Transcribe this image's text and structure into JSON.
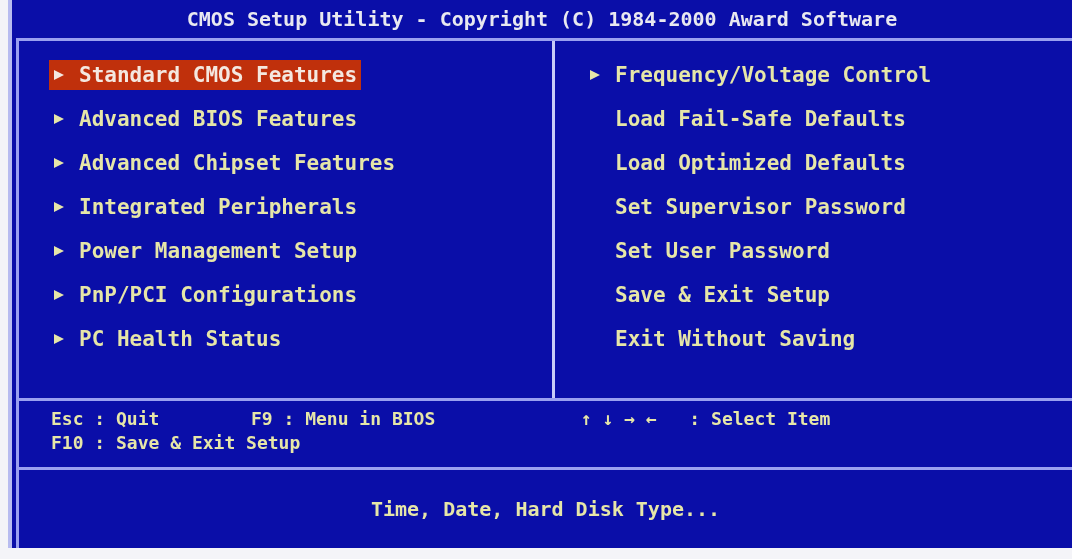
{
  "window": {
    "title": "CMOS Setup Utility - Copyright (C) 1984-2000 Award Software"
  },
  "menu_left": [
    {
      "label": "Standard CMOS Features",
      "kind": "submenu",
      "selected": true
    },
    {
      "label": "Advanced BIOS Features",
      "kind": "submenu",
      "selected": false
    },
    {
      "label": "Advanced Chipset Features",
      "kind": "submenu",
      "selected": false
    },
    {
      "label": "Integrated Peripherals",
      "kind": "submenu",
      "selected": false
    },
    {
      "label": "Power Management Setup",
      "kind": "submenu",
      "selected": false
    },
    {
      "label": "PnP/PCI Configurations",
      "kind": "submenu",
      "selected": false
    },
    {
      "label": "PC Health Status",
      "kind": "submenu",
      "selected": false
    }
  ],
  "menu_right": [
    {
      "label": "Frequency/Voltage Control",
      "kind": "submenu",
      "selected": false
    },
    {
      "label": "Load Fail-Safe Defaults",
      "kind": "action",
      "selected": false
    },
    {
      "label": "Load Optimized Defaults",
      "kind": "action",
      "selected": false
    },
    {
      "label": "Set Supervisor Password",
      "kind": "action",
      "selected": false
    },
    {
      "label": "Set User Password",
      "kind": "action",
      "selected": false
    },
    {
      "label": "Save & Exit Setup",
      "kind": "action",
      "selected": false
    },
    {
      "label": "Exit Without Saving",
      "kind": "action",
      "selected": false
    }
  ],
  "key_help": [
    {
      "key": "Esc : Quit"
    },
    {
      "key": "F9 : Menu in BIOS"
    },
    {
      "key": "↑ ↓ → ←   : Select Item"
    },
    {
      "key": "F10 : Save & Exit Setup"
    }
  ],
  "description": "Time, Date, Hard Disk Type..."
}
